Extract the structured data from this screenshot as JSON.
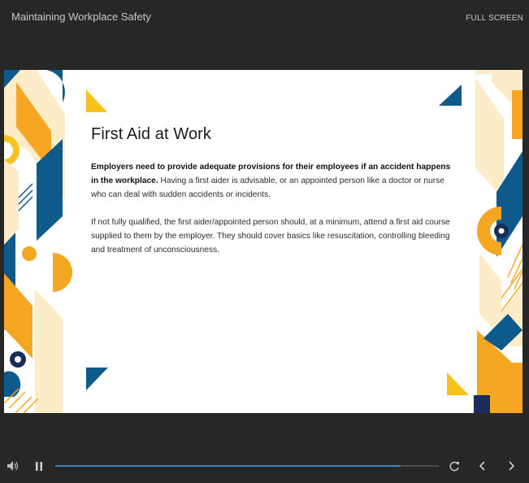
{
  "header": {
    "title": "Maintaining Workplace Safety",
    "fullscreen_label": "FULL SCREEN"
  },
  "slide": {
    "heading": "First Aid at Work",
    "paragraph1_bold": "Employers need to provide adequate provisions for their employees if an accident happens in the workplace.",
    "paragraph1_rest": " Having a first aider is advisable, or an appointed person like a doctor or nurse who can deal with sudden accidents or incidents.",
    "paragraph2": "If not fully qualified, the first aider/appointed person should, at a minimum, attend a first aid course supplied to them by the employer. They should cover basics like resuscitation, controlling bleeding and treatment of unconsciousness."
  },
  "player": {
    "progress": 0.9,
    "icons": [
      "volume-icon",
      "pause-icon",
      "replay-icon",
      "previous-icon",
      "next-icon"
    ]
  },
  "colors": {
    "background": "#272727",
    "navy": "#0e5a8a",
    "orange": "#f5a623",
    "yellow": "#f7c21a",
    "cream": "#fdecc8",
    "dark_navy": "#1a2d5a",
    "progress": "#3b82c4"
  }
}
